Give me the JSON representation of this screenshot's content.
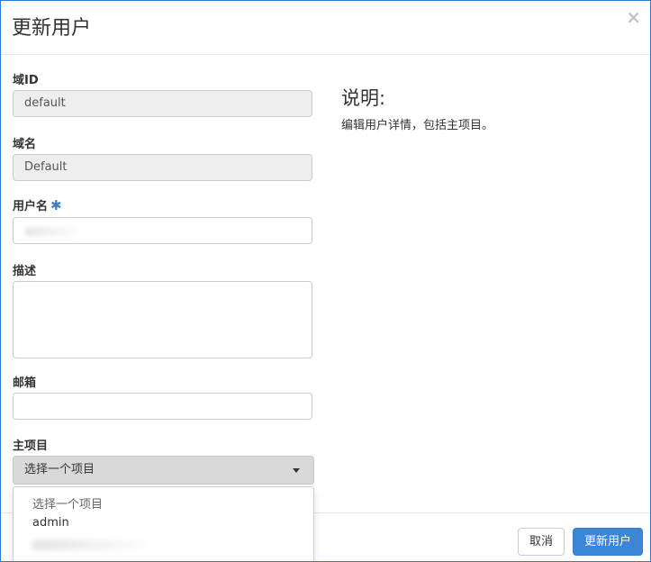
{
  "dialog": {
    "title": "更新用户",
    "close_icon": "×"
  },
  "form": {
    "domain_id": {
      "label": "域ID",
      "value": "default"
    },
    "domain_name": {
      "label": "域名",
      "value": "Default"
    },
    "username": {
      "label": "用户名",
      "required_mark": "✱",
      "value": ""
    },
    "description": {
      "label": "描述",
      "value": ""
    },
    "email": {
      "label": "邮箱",
      "value": ""
    },
    "primary_project": {
      "label": "主项目",
      "selected": "选择一个项目",
      "options": [
        "选择一个项目",
        "admin"
      ]
    }
  },
  "help": {
    "title": "说明:",
    "text": "编辑用户详情，包括主项目。"
  },
  "footer": {
    "cancel_label": "取消",
    "submit_label": "更新用户"
  },
  "colors": {
    "accent": "#3b86d6",
    "border": "#2f7ad1"
  }
}
